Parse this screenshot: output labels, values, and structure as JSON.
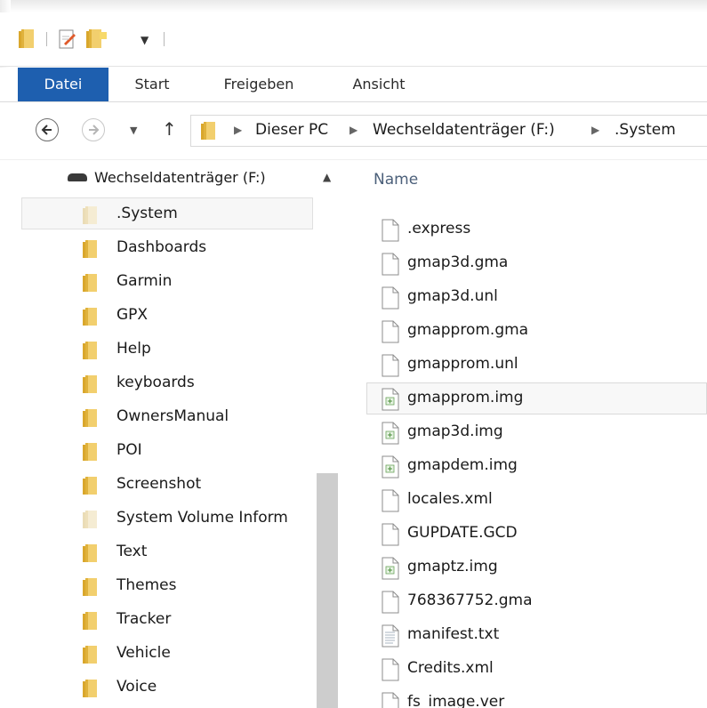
{
  "ribbon": {
    "tabs": [
      {
        "label": "Datei",
        "active": true
      },
      {
        "label": "Start"
      },
      {
        "label": "Freigeben"
      },
      {
        "label": "Ansicht"
      }
    ]
  },
  "address": {
    "crumbs": [
      "Dieser PC",
      "Wechseldatenträger (F:)",
      ".System"
    ]
  },
  "nav_tree": {
    "root_label": "Wechseldatenträger (F:)",
    "items": [
      {
        "label": ".System",
        "selected": true,
        "faded": true
      },
      {
        "label": "Dashboards"
      },
      {
        "label": "Garmin"
      },
      {
        "label": "GPX"
      },
      {
        "label": "Help"
      },
      {
        "label": "keyboards"
      },
      {
        "label": "OwnersManual"
      },
      {
        "label": "POI"
      },
      {
        "label": "Screenshot"
      },
      {
        "label": "System Volume Inform",
        "faded": true
      },
      {
        "label": "Text"
      },
      {
        "label": "Themes"
      },
      {
        "label": "Tracker"
      },
      {
        "label": "Vehicle"
      },
      {
        "label": "Voice"
      }
    ]
  },
  "file_list": {
    "column_name": "Name",
    "files": [
      {
        "name": ".express",
        "icon": "blank-file-icon"
      },
      {
        "name": "gmap3d.gma",
        "icon": "blank-file-icon"
      },
      {
        "name": "gmap3d.unl",
        "icon": "blank-file-icon"
      },
      {
        "name": "gmapprom.gma",
        "icon": "blank-file-icon"
      },
      {
        "name": "gmapprom.unl",
        "icon": "blank-file-icon"
      },
      {
        "name": "gmapprom.img",
        "icon": "image-file-icon",
        "selected": true
      },
      {
        "name": "gmap3d.img",
        "icon": "image-file-icon"
      },
      {
        "name": "gmapdem.img",
        "icon": "image-file-icon"
      },
      {
        "name": "locales.xml",
        "icon": "blank-file-icon"
      },
      {
        "name": "GUPDATE.GCD",
        "icon": "blank-file-icon"
      },
      {
        "name": "gmaptz.img",
        "icon": "image-file-icon"
      },
      {
        "name": "768367752.gma",
        "icon": "blank-file-icon"
      },
      {
        "name": "manifest.txt",
        "icon": "text-file-icon"
      },
      {
        "name": "Credits.xml",
        "icon": "blank-file-icon"
      },
      {
        "name": "fs_image.ver",
        "icon": "blank-file-icon"
      }
    ]
  },
  "colors": {
    "file_tab": "#1e5faf",
    "folder_yellow": "#e8c15a",
    "header_text": "#4c607a"
  }
}
